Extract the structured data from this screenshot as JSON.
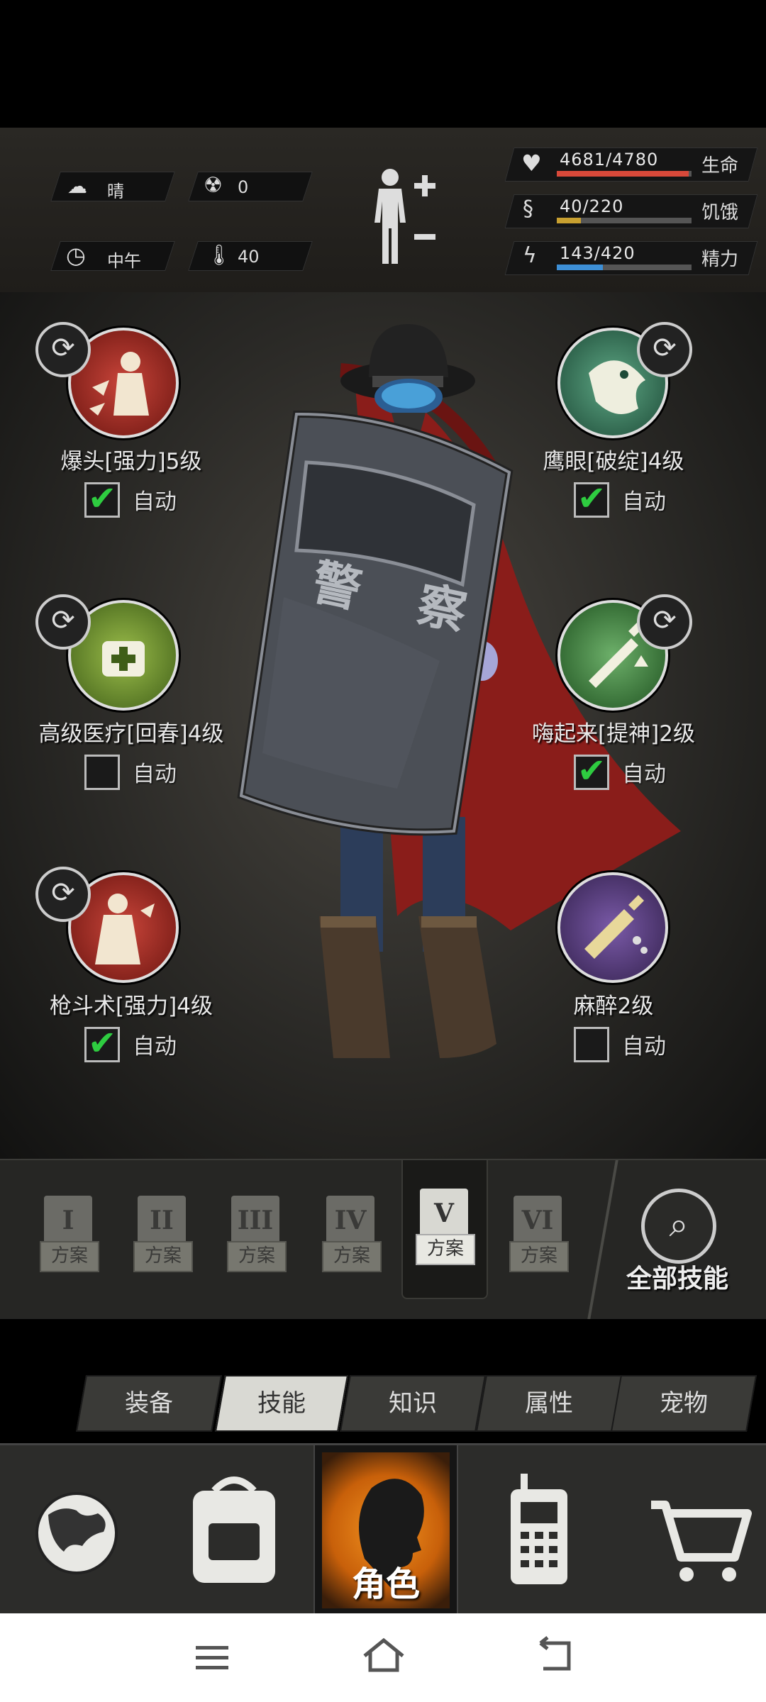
{
  "status": {
    "weather": "晴",
    "radiation": "0",
    "time_of_day": "中午",
    "temperature": "40",
    "health": {
      "value": "4681/4780",
      "label": "生命",
      "fraction": 0.979,
      "color": "#d8493a"
    },
    "hunger": {
      "value": "40/220",
      "label": "饥饿",
      "fraction": 0.18,
      "color": "#c8a030"
    },
    "energy": {
      "value": "143/420",
      "label": "精力",
      "fraction": 0.34,
      "color": "#3d8fd6"
    }
  },
  "skills": {
    "s1": {
      "name": "爆头[强力]5级",
      "auto_label": "自动",
      "auto": true
    },
    "s2": {
      "name": "鹰眼[破绽]4级",
      "auto_label": "自动",
      "auto": true
    },
    "s3": {
      "name": "高级医疗[回春]4级",
      "auto_label": "自动",
      "auto": false
    },
    "s4": {
      "name": "嗨起来[提神]2级",
      "auto_label": "自动",
      "auto": true
    },
    "s5": {
      "name": "枪斗术[强力]4级",
      "auto_label": "自动",
      "auto": true
    },
    "s6": {
      "name": "麻醉2级",
      "auto_label": "自动",
      "auto": false
    }
  },
  "scene_text": {
    "shield_text": "警 察"
  },
  "plans": {
    "items": [
      {
        "numeral": "I",
        "label": "方案"
      },
      {
        "numeral": "II",
        "label": "方案"
      },
      {
        "numeral": "III",
        "label": "方案"
      },
      {
        "numeral": "IV",
        "label": "方案"
      },
      {
        "numeral": "V",
        "label": "方案"
      },
      {
        "numeral": "VI",
        "label": "方案"
      }
    ],
    "all_skills_label": "全部技能"
  },
  "category_tabs": [
    "装备",
    "技能",
    "知识",
    "属性",
    "宠物"
  ],
  "nav": {
    "character_label": "角色"
  },
  "colors": {
    "check_green": "#2ecc40",
    "nav_active": "#e87a12"
  }
}
